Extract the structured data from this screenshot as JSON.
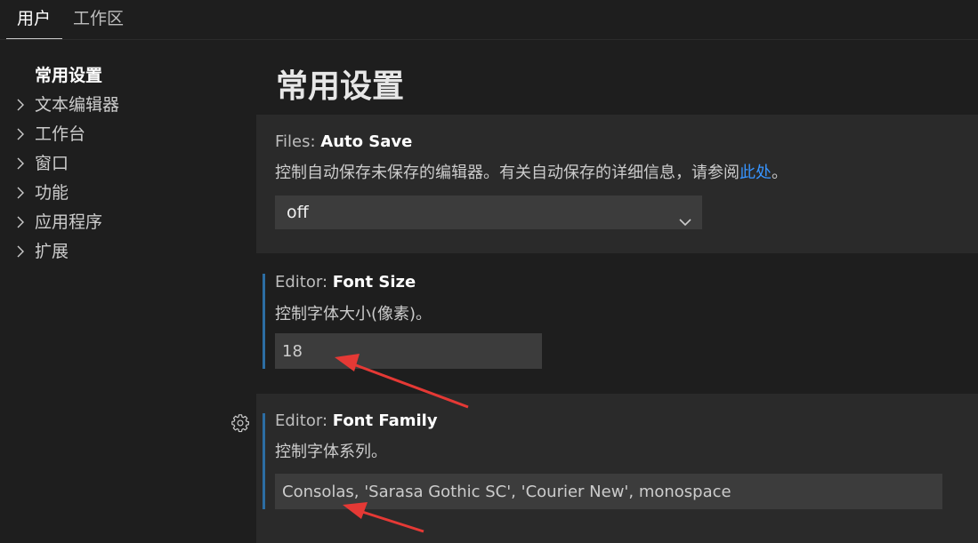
{
  "tabs": {
    "user": "用户",
    "workspace": "工作区"
  },
  "toc": [
    {
      "label": "常用设置",
      "expandable": false,
      "active": true
    },
    {
      "label": "文本编辑器",
      "expandable": true
    },
    {
      "label": "工作台",
      "expandable": true
    },
    {
      "label": "窗口",
      "expandable": true
    },
    {
      "label": "功能",
      "expandable": true
    },
    {
      "label": "应用程序",
      "expandable": true
    },
    {
      "label": "扩展",
      "expandable": true
    }
  ],
  "page_title": "常用设置",
  "settings": {
    "auto_save": {
      "category": "Files: ",
      "name": "Auto Save",
      "description": "控制自动保存未保存的编辑器。有关自动保存的详细信息，请参阅",
      "link_text": "此处",
      "description_suffix": "。",
      "value": "off"
    },
    "font_size": {
      "category": "Editor: ",
      "name": "Font Size",
      "description": "控制字体大小(像素)。",
      "value": "18"
    },
    "font_family": {
      "category": "Editor: ",
      "name": "Font Family",
      "description": "控制字体系列。",
      "value": "Consolas, 'Sarasa Gothic SC', 'Courier New', monospace"
    }
  },
  "icons": {
    "gear": "gear-icon",
    "chevron": "chevron-right-icon",
    "dropdown": "chevron-down-icon"
  },
  "colors": {
    "accent_link": "#3794ff",
    "modified_bar": "#2c6da3",
    "annotation_arrow": "#e53935"
  }
}
